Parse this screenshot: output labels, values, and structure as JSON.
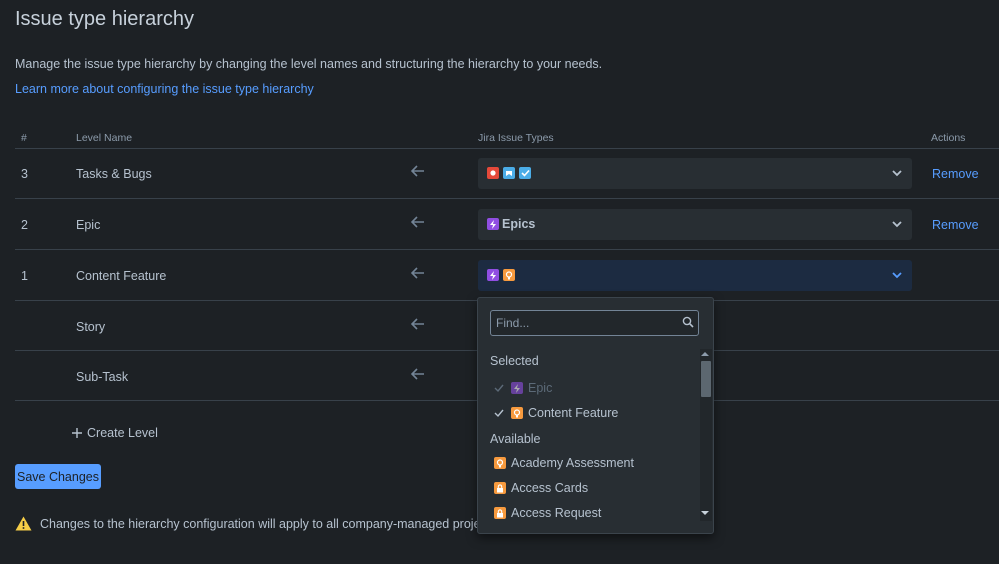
{
  "page": {
    "title": "Issue type hierarchy",
    "description": "Manage the issue type hierarchy by changing the level names and structuring the hierarchy to your needs.",
    "learn_more": "Learn more about configuring the issue type hierarchy"
  },
  "table": {
    "headers": {
      "num": "#",
      "level_name": "Level Name",
      "issue_types": "Jira Issue Types",
      "actions": "Actions"
    },
    "rows": [
      {
        "num": "3",
        "name": "Tasks & Bugs",
        "selected_label": "",
        "icons": [
          "bug-icon",
          "story-icon",
          "task-icon"
        ],
        "action": "Remove"
      },
      {
        "num": "2",
        "name": "Epic",
        "selected_label": "Epics",
        "icons": [
          "epic-icon"
        ],
        "action": "Remove"
      },
      {
        "num": "1",
        "name": "Content Feature",
        "selected_label": "",
        "icons": [
          "epic-icon",
          "feature-icon"
        ],
        "action": ""
      },
      {
        "num": "",
        "name": "Story"
      },
      {
        "num": "",
        "name": "Sub-Task"
      }
    ]
  },
  "create_level": "Create Level",
  "save_button": "Save Changes",
  "warning": "Changes to the hierarchy configuration will apply to all company-managed projects.",
  "dropdown": {
    "search_placeholder": "Find...",
    "selected_heading": "Selected",
    "selected": [
      {
        "label": "Epic",
        "icon": "epic-icon",
        "disabled": true
      },
      {
        "label": "Content Feature",
        "icon": "feature-icon",
        "disabled": false
      }
    ],
    "available_heading": "Available",
    "available": [
      {
        "label": "Academy Assessment",
        "icon": "feature-icon"
      },
      {
        "label": "Access Cards",
        "icon": "lock-icon"
      },
      {
        "label": "Access Request",
        "icon": "lock-icon"
      }
    ]
  },
  "colors": {
    "background": "#1d2125",
    "link": "#579dff",
    "bug": "#e5493a",
    "story": "#4bade8",
    "task": "#4bade8",
    "epic": "#904ee2",
    "feature": "#f79a3e",
    "warning": "#f5cd47"
  }
}
